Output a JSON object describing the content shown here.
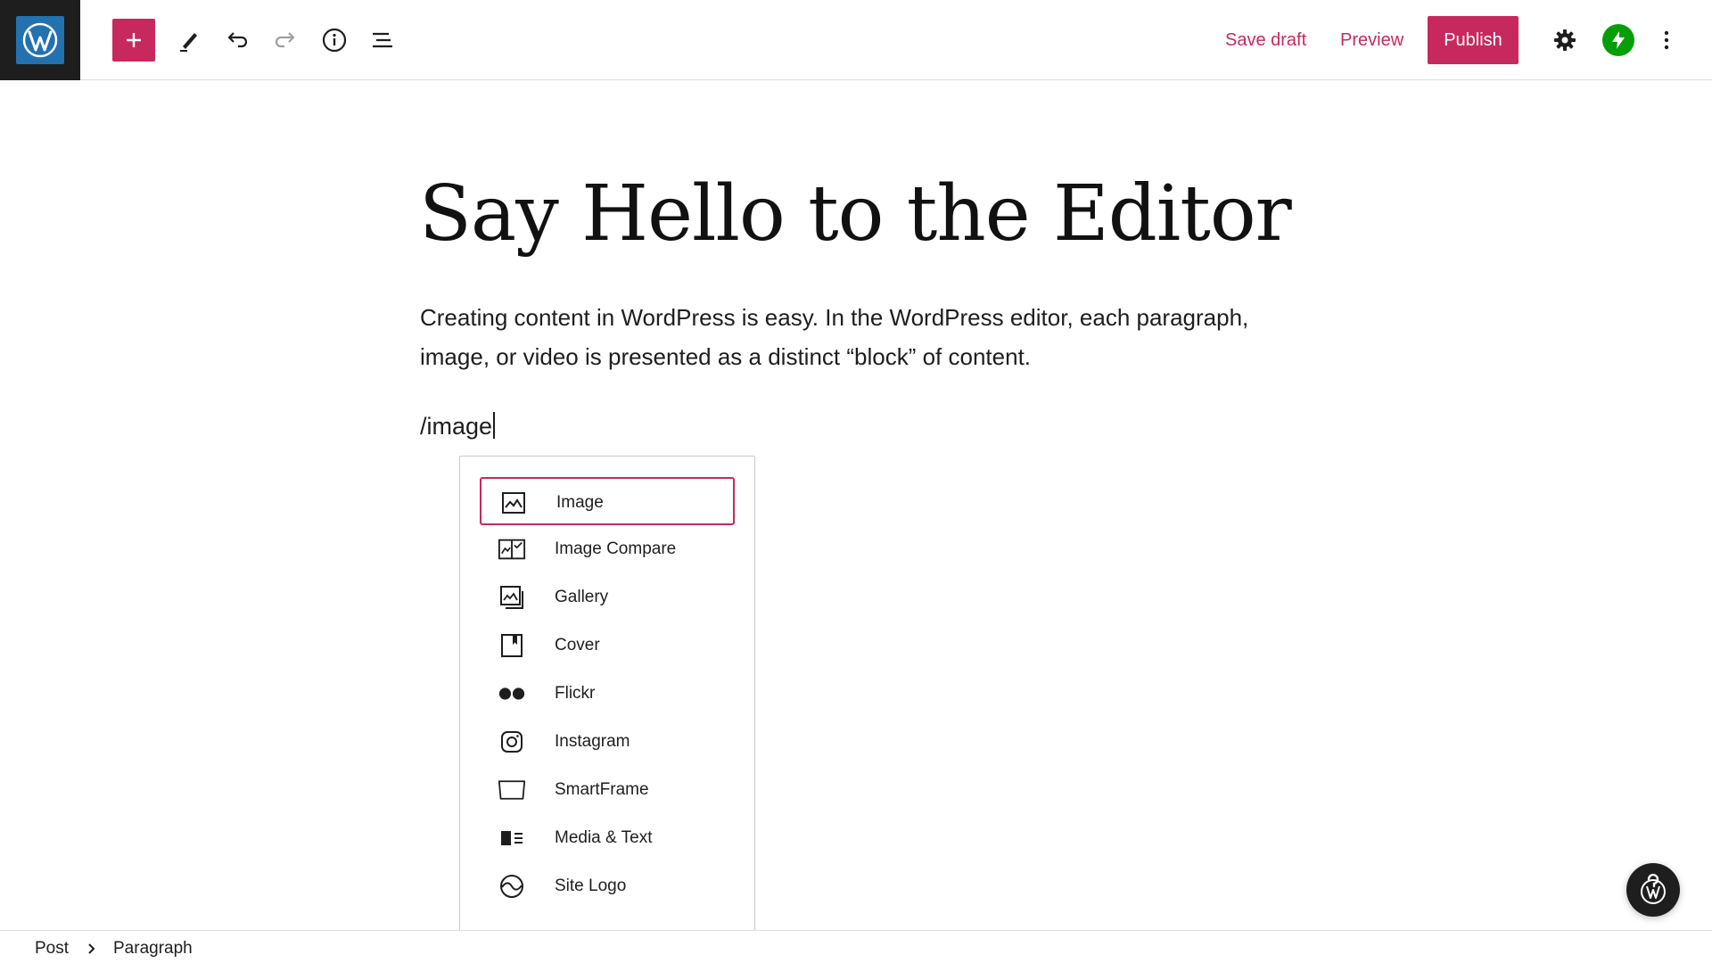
{
  "toolbar": {
    "save_draft_label": "Save draft",
    "preview_label": "Preview",
    "publish_label": "Publish",
    "icons": [
      "wordpress-logo",
      "plus",
      "pencil-tools",
      "undo",
      "redo",
      "info",
      "list-view",
      "gear",
      "jetpack-bolt",
      "more-vertical"
    ]
  },
  "post": {
    "title": "Say Hello to the Editor",
    "paragraph_lines": [
      "Creating content in WordPress is easy. In the WordPress editor, each paragraph,",
      "image, or video is presented as a distinct “block” of content."
    ],
    "slash_command": "/image"
  },
  "inserter": {
    "items": [
      {
        "label": "Image",
        "icon": "image-icon",
        "selected": true
      },
      {
        "label": "Image Compare",
        "icon": "image-compare-icon",
        "selected": false
      },
      {
        "label": "Gallery",
        "icon": "gallery-icon",
        "selected": false
      },
      {
        "label": "Cover",
        "icon": "cover-icon",
        "selected": false
      },
      {
        "label": "Flickr",
        "icon": "flickr-icon",
        "selected": false
      },
      {
        "label": "Instagram",
        "icon": "instagram-icon",
        "selected": false
      },
      {
        "label": "SmartFrame",
        "icon": "smartframe-icon",
        "selected": false
      },
      {
        "label": "Media & Text",
        "icon": "media-text-icon",
        "selected": false
      },
      {
        "label": "Site Logo",
        "icon": "site-logo-icon",
        "selected": false
      }
    ]
  },
  "breadcrumb": {
    "items": [
      "Post",
      "Paragraph"
    ]
  },
  "colors": {
    "accent": "#c7295e",
    "wp_blue": "#2271b1",
    "dark": "#1e1e1e",
    "jetpack_green": "#069e08"
  }
}
